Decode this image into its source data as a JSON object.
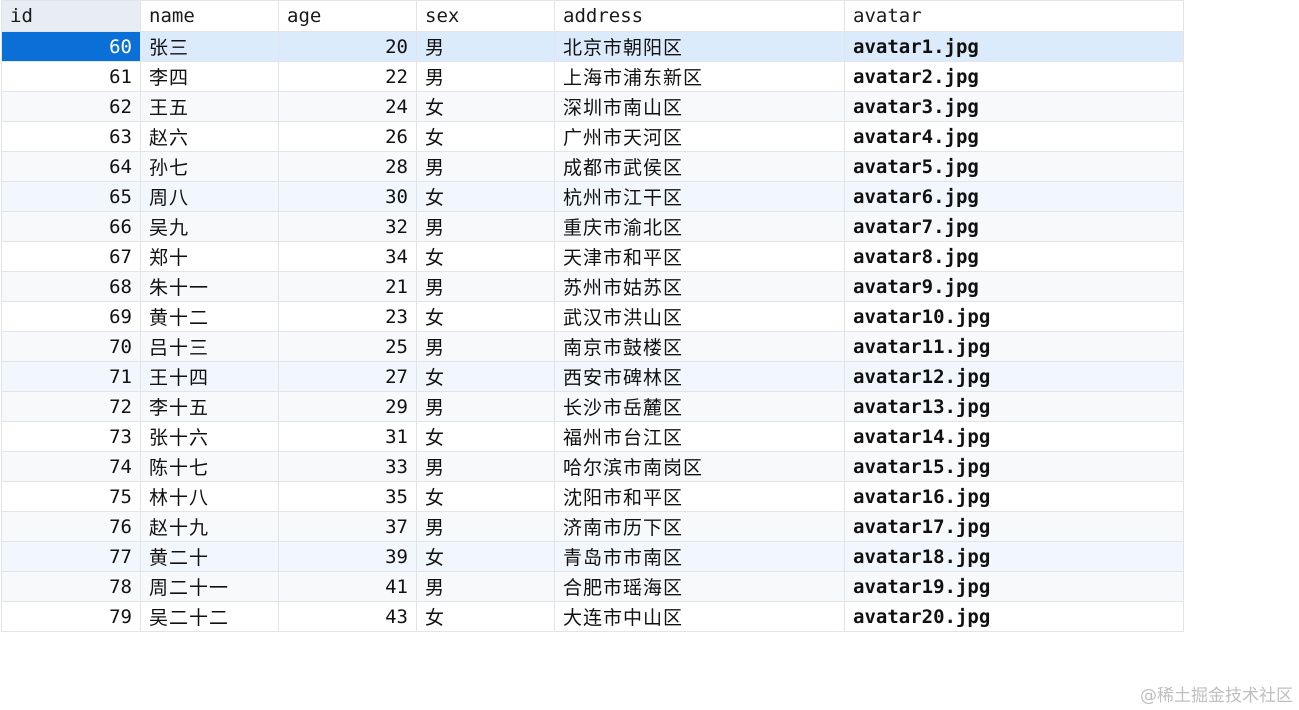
{
  "table": {
    "columns": [
      "id",
      "name",
      "age",
      "sex",
      "address",
      "avatar"
    ],
    "rows": [
      {
        "id": "60",
        "name": "张三",
        "age": "20",
        "sex": "男",
        "address": "北京市朝阳区",
        "avatar": "avatar1.jpg"
      },
      {
        "id": "61",
        "name": "李四",
        "age": "22",
        "sex": "男",
        "address": "上海市浦东新区",
        "avatar": "avatar2.jpg"
      },
      {
        "id": "62",
        "name": "王五",
        "age": "24",
        "sex": "女",
        "address": "深圳市南山区",
        "avatar": "avatar3.jpg"
      },
      {
        "id": "63",
        "name": "赵六",
        "age": "26",
        "sex": "女",
        "address": "广州市天河区",
        "avatar": "avatar4.jpg"
      },
      {
        "id": "64",
        "name": "孙七",
        "age": "28",
        "sex": "男",
        "address": "成都市武侯区",
        "avatar": "avatar5.jpg"
      },
      {
        "id": "65",
        "name": "周八",
        "age": "30",
        "sex": "女",
        "address": "杭州市江干区",
        "avatar": "avatar6.jpg"
      },
      {
        "id": "66",
        "name": "吴九",
        "age": "32",
        "sex": "男",
        "address": "重庆市渝北区",
        "avatar": "avatar7.jpg"
      },
      {
        "id": "67",
        "name": "郑十",
        "age": "34",
        "sex": "女",
        "address": "天津市和平区",
        "avatar": "avatar8.jpg"
      },
      {
        "id": "68",
        "name": "朱十一",
        "age": "21",
        "sex": "男",
        "address": "苏州市姑苏区",
        "avatar": "avatar9.jpg"
      },
      {
        "id": "69",
        "name": "黄十二",
        "age": "23",
        "sex": "女",
        "address": "武汉市洪山区",
        "avatar": "avatar10.jpg"
      },
      {
        "id": "70",
        "name": "吕十三",
        "age": "25",
        "sex": "男",
        "address": "南京市鼓楼区",
        "avatar": "avatar11.jpg"
      },
      {
        "id": "71",
        "name": "王十四",
        "age": "27",
        "sex": "女",
        "address": "西安市碑林区",
        "avatar": "avatar12.jpg"
      },
      {
        "id": "72",
        "name": "李十五",
        "age": "29",
        "sex": "男",
        "address": "长沙市岳麓区",
        "avatar": "avatar13.jpg"
      },
      {
        "id": "73",
        "name": "张十六",
        "age": "31",
        "sex": "女",
        "address": "福州市台江区",
        "avatar": "avatar14.jpg"
      },
      {
        "id": "74",
        "name": "陈十七",
        "age": "33",
        "sex": "男",
        "address": "哈尔滨市南岗区",
        "avatar": "avatar15.jpg"
      },
      {
        "id": "75",
        "name": "林十八",
        "age": "35",
        "sex": "女",
        "address": "沈阳市和平区",
        "avatar": "avatar16.jpg"
      },
      {
        "id": "76",
        "name": "赵十九",
        "age": "37",
        "sex": "男",
        "address": "济南市历下区",
        "avatar": "avatar17.jpg"
      },
      {
        "id": "77",
        "name": "黄二十",
        "age": "39",
        "sex": "女",
        "address": "青岛市市南区",
        "avatar": "avatar18.jpg"
      },
      {
        "id": "78",
        "name": "周二十一",
        "age": "41",
        "sex": "男",
        "address": "合肥市瑶海区",
        "avatar": "avatar19.jpg"
      },
      {
        "id": "79",
        "name": "吴二十二",
        "age": "43",
        "sex": "女",
        "address": "大连市中山区",
        "avatar": "avatar20.jpg"
      }
    ],
    "selected_row": 0
  },
  "watermark": "@稀土掘金技术社区"
}
